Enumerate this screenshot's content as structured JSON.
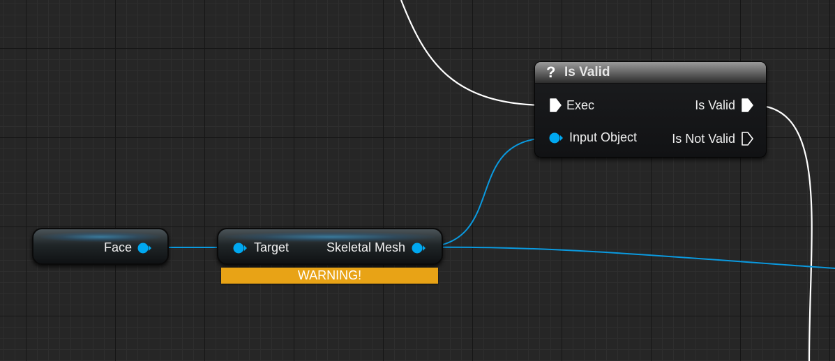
{
  "graph": {
    "is_valid_node": {
      "title": "Is Valid",
      "title_icon": "?",
      "icon_name": "question-mark-icon",
      "inputs": {
        "exec_label": "Exec",
        "object_label": "Input Object"
      },
      "outputs": {
        "valid_label": "Is Valid",
        "not_valid_label": "Is Not Valid"
      }
    },
    "face_node": {
      "output_label": "Face"
    },
    "getter_node": {
      "input_label": "Target",
      "output_label": "Skeletal Mesh",
      "warning_text": "WARNING!"
    }
  },
  "colors": {
    "background": "#262626",
    "exec_wire": "#ffffff",
    "object_pin": "#00a8f0",
    "object_wire": "#0a9ae0",
    "warning": "#e8a316"
  }
}
